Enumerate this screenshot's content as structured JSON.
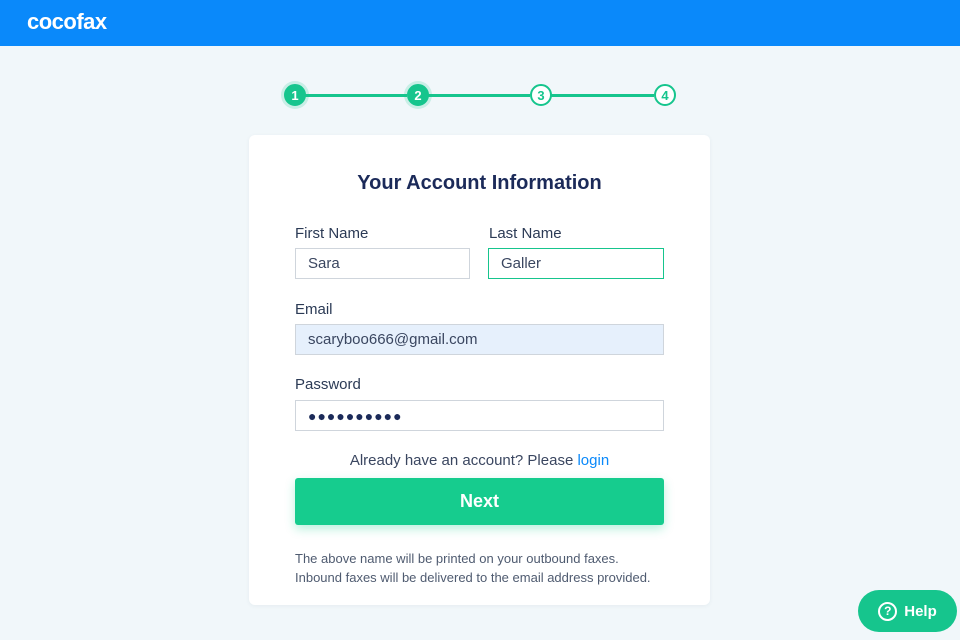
{
  "brand": {
    "name": "cocofax",
    "color": "#0a89fa"
  },
  "stepper": {
    "steps": [
      {
        "label": "1",
        "state": "done"
      },
      {
        "label": "2",
        "state": "done"
      },
      {
        "label": "3",
        "state": "todo"
      },
      {
        "label": "4",
        "state": "todo"
      }
    ],
    "current_step": 2,
    "accent": "#16c58d"
  },
  "form": {
    "title": "Your Account Information",
    "first_name": {
      "label": "First Name",
      "value": "Sara"
    },
    "last_name": {
      "label": "Last Name",
      "value": "Galler"
    },
    "email": {
      "label": "Email",
      "value": "scaryboo666@gmail.com"
    },
    "password": {
      "label": "Password",
      "value": "●●●●●●●●●●"
    },
    "login_prompt": "Already have an account? Please",
    "login_link": "login",
    "next_button": "Next",
    "note_line1": "The above name will be printed on your outbound faxes.",
    "note_line2": "Inbound faxes will be delivered to the email address provided."
  },
  "help": {
    "label": "Help",
    "icon": "question-circle-icon"
  }
}
